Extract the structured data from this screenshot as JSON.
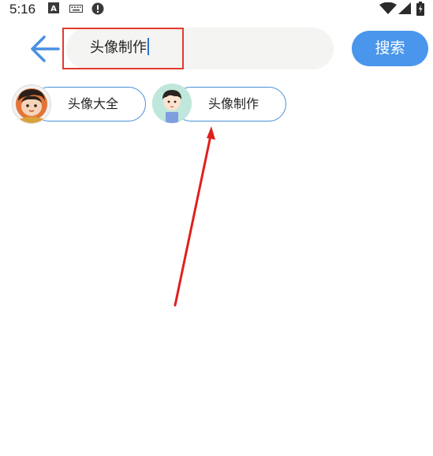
{
  "status_bar": {
    "time": "5:16",
    "icons": [
      "a-icon",
      "keyboard-icon",
      "alert-icon",
      "wifi-icon",
      "signal-icon",
      "battery-icon"
    ]
  },
  "search": {
    "query": "头像制作",
    "button_label": "搜索"
  },
  "chips": [
    {
      "label": "头像大全",
      "avatar": "boy-avatar-icon"
    },
    {
      "label": "头像制作",
      "avatar": "boy-avatar-icon"
    }
  ],
  "colors": {
    "accent": "#4996ec",
    "chip_border": "#4a8fd9",
    "highlight": "#e13a2f",
    "search_bg": "#f4f4f2"
  }
}
